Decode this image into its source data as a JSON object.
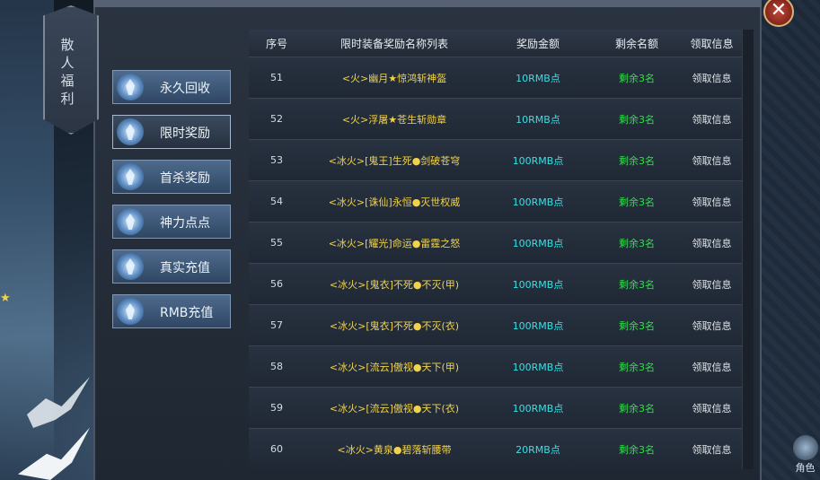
{
  "panel": {
    "title_chars": [
      "散",
      "人",
      "福",
      "利"
    ],
    "close_label": "✕"
  },
  "side_menu": [
    {
      "label": "永久回收",
      "active": false
    },
    {
      "label": "限时奖励",
      "active": true
    },
    {
      "label": "首杀奖励",
      "active": false
    },
    {
      "label": "神力点点",
      "active": false
    },
    {
      "label": "真实充值",
      "active": false
    },
    {
      "label": "RMB充值",
      "active": false
    }
  ],
  "table": {
    "headers": {
      "id": "序号",
      "name": "限时装备奖励名称列表",
      "amount": "奖励金额",
      "remaining": "剩余名额",
      "action": "领取信息"
    },
    "rows": [
      {
        "id": "51",
        "name": "<火>幽月★惊鸿斩神盔",
        "amount": "10RMB点",
        "remaining": "剩余3名",
        "action": "领取信息"
      },
      {
        "id": "52",
        "name": "<火>浮屠★苍生斩勋章",
        "amount": "10RMB点",
        "remaining": "剩余3名",
        "action": "领取信息"
      },
      {
        "id": "53",
        "name": "<冰火>[鬼王]生死●剑破苍穹",
        "amount": "100RMB点",
        "remaining": "剩余3名",
        "action": "领取信息"
      },
      {
        "id": "54",
        "name": "<冰火>[诛仙]永恒●灭世权威",
        "amount": "100RMB点",
        "remaining": "剩余3名",
        "action": "领取信息"
      },
      {
        "id": "55",
        "name": "<冰火>[耀光]命运●雷霆之怒",
        "amount": "100RMB点",
        "remaining": "剩余3名",
        "action": "领取信息"
      },
      {
        "id": "56",
        "name": "<冰火>[鬼衣]不死●不灭(甲)",
        "amount": "100RMB点",
        "remaining": "剩余3名",
        "action": "领取信息"
      },
      {
        "id": "57",
        "name": "<冰火>[鬼衣]不死●不灭(衣)",
        "amount": "100RMB点",
        "remaining": "剩余3名",
        "action": "领取信息"
      },
      {
        "id": "58",
        "name": "<冰火>[流云]傲视●天下(甲)",
        "amount": "100RMB点",
        "remaining": "剩余3名",
        "action": "领取信息"
      },
      {
        "id": "59",
        "name": "<冰火>[流云]傲视●天下(衣)",
        "amount": "100RMB点",
        "remaining": "剩余3名",
        "action": "领取信息"
      },
      {
        "id": "60",
        "name": "<冰火>黄泉●碧落斩腰带",
        "amount": "20RMB点",
        "remaining": "剩余3名",
        "action": "领取信息"
      }
    ]
  },
  "role_badge": {
    "label": "角色"
  },
  "colors": {
    "item_name": "#f2d24a",
    "amount": "#39e0e6",
    "remaining": "#31e04a"
  }
}
